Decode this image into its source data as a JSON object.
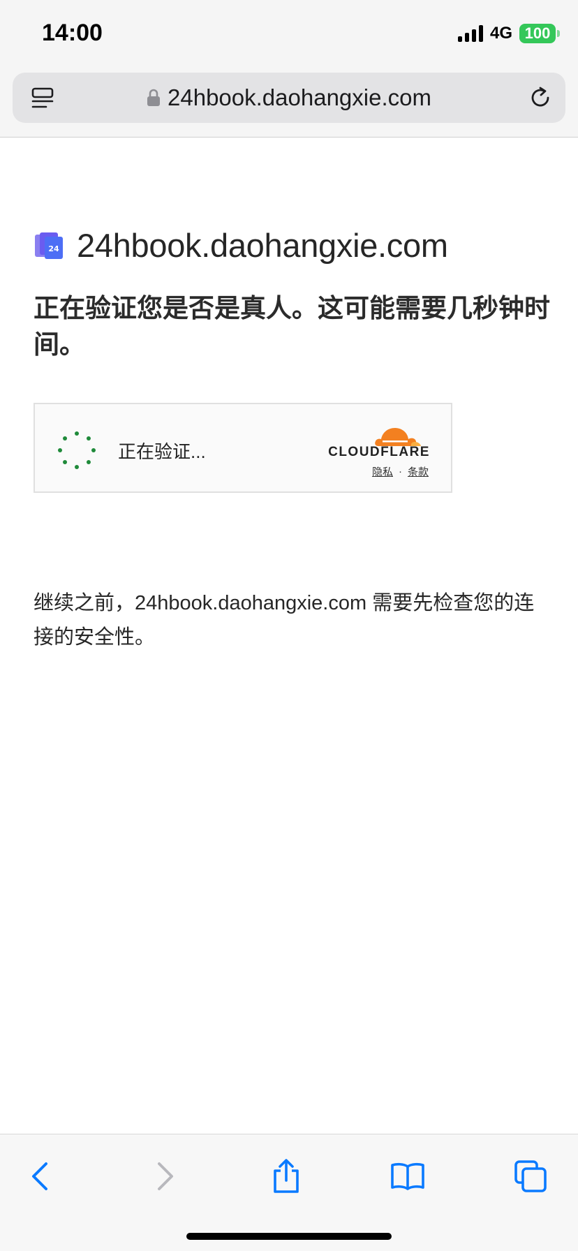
{
  "status_bar": {
    "time": "14:00",
    "network": "4G",
    "battery": "100"
  },
  "browser": {
    "url": "24hbook.daohangxie.com",
    "icons": {
      "reader": "reader-mode-icon",
      "lock": "lock-icon",
      "reload": "reload-icon"
    }
  },
  "page": {
    "domain": "24hbook.daohangxie.com",
    "headline": "正在验证您是否是真人。这可能需要几秒钟时间。",
    "footer_note": "继续之前，24hbook.daohangxie.com 需要先检查您的连接的安全性。"
  },
  "challenge": {
    "status_text": "正在验证...",
    "brand": "CLOUDFLARE",
    "privacy_link": "隐私",
    "separator": "·",
    "terms_link": "条款"
  },
  "toolbar": {
    "icons": [
      "back-icon",
      "forward-icon",
      "share-icon",
      "bookmarks-icon",
      "tabs-icon"
    ]
  },
  "colors": {
    "accent_blue": "#0a7aff",
    "spinner_green": "#1f8a3a",
    "cloudflare_orange": "#f38020",
    "battery_green": "#34c759",
    "disabled_gray": "#b8b8bd"
  }
}
